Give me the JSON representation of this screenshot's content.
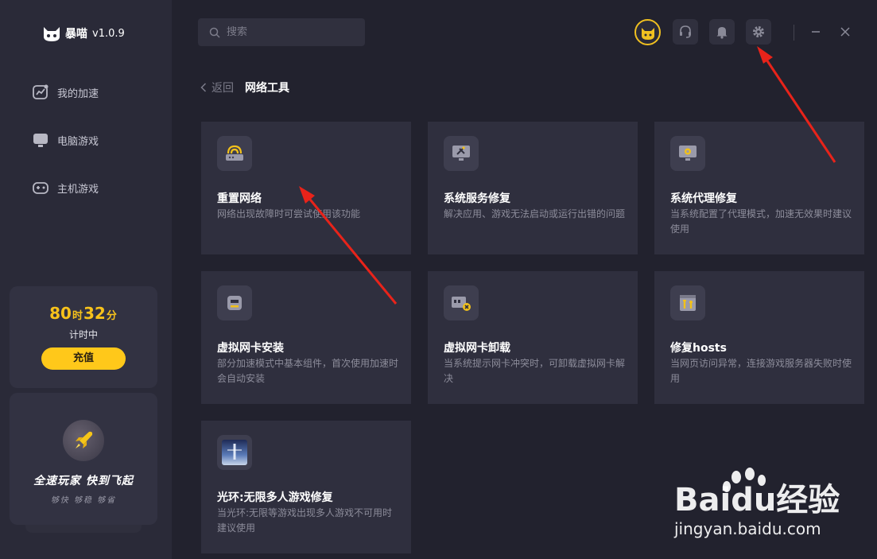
{
  "app": {
    "name": "暴喵",
    "version": "v1.0.9"
  },
  "sidebar": {
    "items": [
      {
        "label": "我的加速",
        "icon": "speed-chart-icon"
      },
      {
        "label": "电脑游戏",
        "icon": "monitor-icon"
      },
      {
        "label": "主机游戏",
        "icon": "gamepad-icon"
      }
    ],
    "timer": {
      "hours": "80",
      "hour_unit": "时",
      "minutes": "32",
      "minute_unit": "分",
      "status": "计时中",
      "recharge_label": "充值"
    },
    "promo": {
      "title": "全速玩家 快到飞起",
      "subtitle": "够快 够稳 够省"
    }
  },
  "search": {
    "placeholder": "搜索"
  },
  "breadcrumb": {
    "back_label": "返回",
    "title": "网络工具"
  },
  "tools": [
    {
      "title": "重置网络",
      "desc": "网络出现故障时可尝试使用该功能",
      "icon": "router-icon"
    },
    {
      "title": "系统服务修复",
      "desc": "解决应用、游戏无法启动或运行出错的问题",
      "icon": "monitor-tools-icon"
    },
    {
      "title": "系统代理修复",
      "desc": "当系统配置了代理模式，加速无效果时建议使用",
      "icon": "monitor-gear-icon"
    },
    {
      "title": "虚拟网卡安装",
      "desc": "部分加速模式中基本组件，首次使用加速时会自动安装",
      "icon": "network-card-icon"
    },
    {
      "title": "虚拟网卡卸载",
      "desc": "当系统提示网卡冲突时，可卸载虚拟网卡解决",
      "icon": "network-card-remove-icon"
    },
    {
      "title": "修复hosts",
      "desc": "当网页访问异常，连接游戏服务器失败时使用",
      "icon": "hosts-tools-icon"
    },
    {
      "title": "光环:无限多人游戏修复",
      "desc": "当光环:无限等游戏出现多人游戏不可用时建议使用",
      "icon": "halo-game-icon"
    }
  ],
  "watermark": {
    "brand": "Baidu经验",
    "url": "jingyan.baidu.com"
  },
  "colors": {
    "accent": "#ffc81a",
    "background": "#22222e",
    "sidebar": "#2a2a38",
    "card": "#2f2f3e",
    "arrow": "#e8231a"
  }
}
